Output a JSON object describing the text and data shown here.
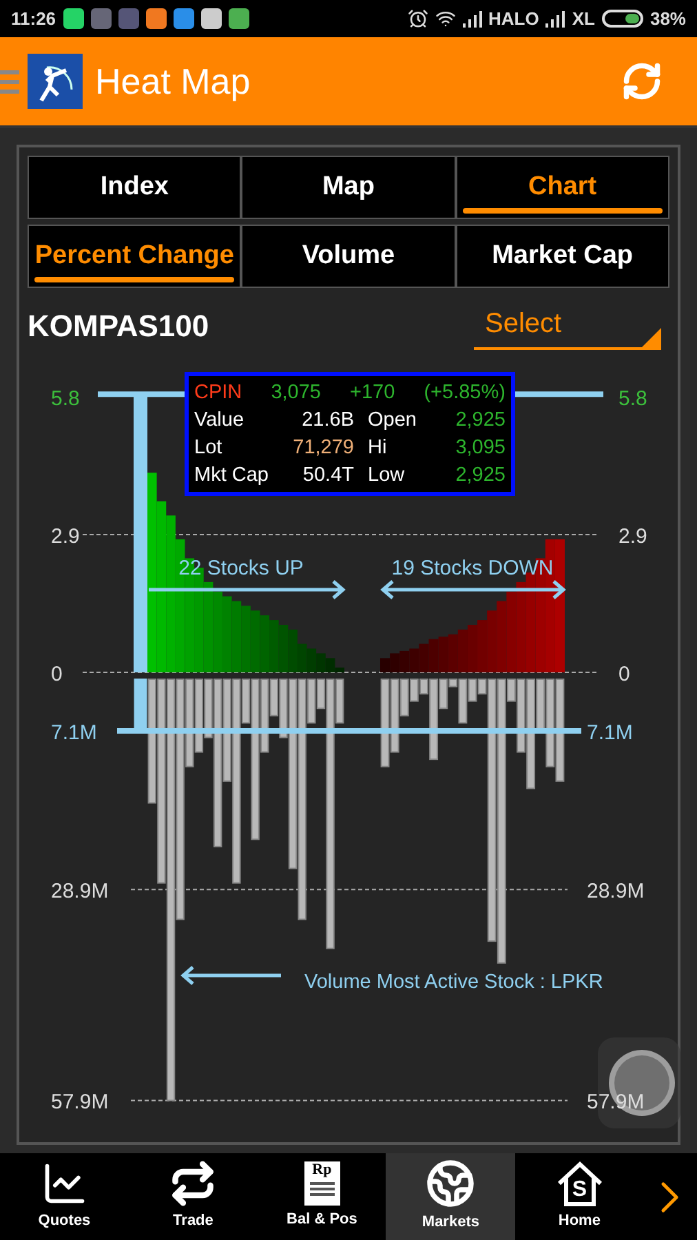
{
  "status_bar": {
    "time": "11:26",
    "carrier_1": "HALO",
    "carrier_2": "XL",
    "battery": "38%"
  },
  "app_bar": {
    "title": "Heat Map"
  },
  "view_tabs": [
    {
      "label": "Index",
      "selected": false
    },
    {
      "label": "Map",
      "selected": false
    },
    {
      "label": "Chart",
      "selected": true
    }
  ],
  "measure_tabs": [
    {
      "label": "Percent Change",
      "selected": true
    },
    {
      "label": "Volume",
      "selected": false
    },
    {
      "label": "Market Cap",
      "selected": false
    }
  ],
  "index_name": "KOMPAS100",
  "select": {
    "placeholder": "Select"
  },
  "tooltip": {
    "code": "CPIN",
    "price": "3,075",
    "change": "+170",
    "percent": "(+5.85%)",
    "rows": [
      {
        "label": "Value",
        "value": "21.6B",
        "label_2": "Open",
        "value_2": "2,925"
      },
      {
        "label": "Lot",
        "value": "71,279",
        "label_2": "Hi",
        "value_2": "3,095"
      },
      {
        "label": "Mkt Cap",
        "value": "50.4T",
        "label_2": "Low",
        "value_2": "2,925"
      }
    ]
  },
  "heat_map_chart": {
    "percent_left_ticks": [
      "5.8",
      "2.9",
      "0"
    ],
    "percent_right_ticks": [
      "5.8",
      "2.9",
      "0"
    ],
    "volume_left_ticks": [
      "7.1M",
      "28.9M",
      "57.9M"
    ],
    "volume_right_ticks": [
      "7.1M",
      "28.9M",
      "57.9M"
    ],
    "up_label": "22 Stocks UP",
    "down_label": "19 Stocks DOWN",
    "most_active_label": "Volume Most Active Stock : LPKR"
  },
  "bottom_nav": [
    {
      "label": "Quotes",
      "kind": "quotes",
      "selected": false
    },
    {
      "label": "Trade",
      "kind": "trade",
      "selected": false
    },
    {
      "label": "Bal & Pos",
      "kind": "balance",
      "icon_text": "Rp",
      "selected": false
    },
    {
      "label": "Markets",
      "kind": "markets",
      "selected": true
    },
    {
      "label": "Home",
      "kind": "home",
      "icon_text": "S",
      "selected": false
    }
  ]
}
